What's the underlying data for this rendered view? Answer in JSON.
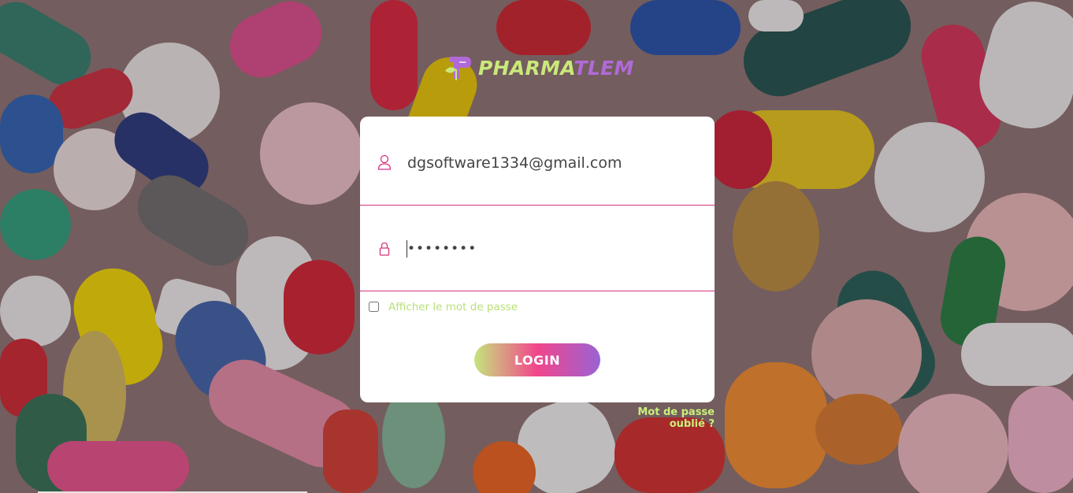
{
  "brand": {
    "name_part1": "PHARMA",
    "name_part2": "TLEM",
    "logo": "pharmacy-p-leaf-logo",
    "color_part1": "#c9e97a",
    "color_part2": "#b06ad8"
  },
  "background": {
    "description_icon": "pills-background"
  },
  "form": {
    "username": {
      "value": "dgsoftware1334@gmail.com",
      "icon": "user-icon"
    },
    "password": {
      "value": "••••••••",
      "icon": "lock-icon"
    },
    "show_password_label": "Afficher le mot de passe",
    "show_password_checked": false,
    "login_label": "LOGIN"
  },
  "forgot_password_label": "Mot de passe oublié ?",
  "colors": {
    "accent_border": "#d6337f",
    "gradient": [
      "#c6e47c",
      "#f1458c",
      "#9a63d4"
    ],
    "link_green": "#c9f07a"
  }
}
